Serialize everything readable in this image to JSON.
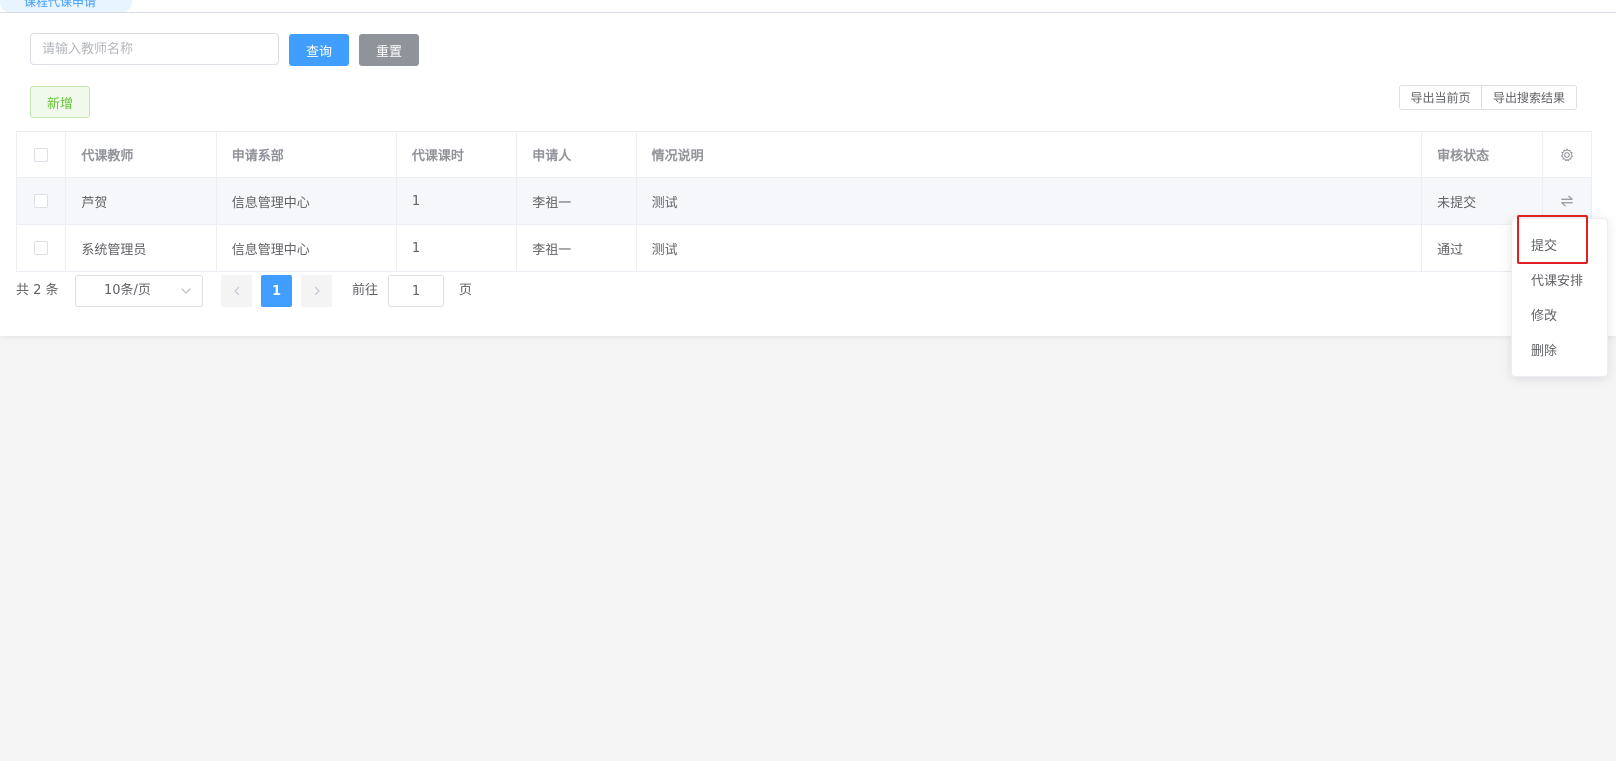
{
  "header": {
    "active_tab": "课程代课申请"
  },
  "search": {
    "placeholder": "请输入教师名称",
    "value": ""
  },
  "toolbar": {
    "query_label": "查询",
    "reset_label": "重置",
    "add_label": "新增",
    "export_current_label": "导出当前页",
    "export_search_label": "导出搜索结果"
  },
  "table": {
    "columns": [
      "代课教师",
      "申请系部",
      "代课课时",
      "申请人",
      "情况说明",
      "审核状态"
    ],
    "rows": [
      {
        "teacher": "芦贺",
        "department": "信息管理中心",
        "hours": "1",
        "applicant": "李祖一",
        "description": "测试",
        "status": "未提交"
      },
      {
        "teacher": "系统管理员",
        "department": "信息管理中心",
        "hours": "1",
        "applicant": "李祖一",
        "description": "测试",
        "status": "通过"
      }
    ],
    "settings_icon": "gear-icon",
    "row_action_icon": "swap-icon"
  },
  "pagination": {
    "total_text": "共 2 条",
    "page_size": "10条/页",
    "current_page": "1",
    "goto_label": "前往",
    "goto_value": "1",
    "page_unit": "页"
  },
  "dropdown_menu": {
    "items": [
      "提交",
      "代课安排",
      "修改",
      "删除"
    ],
    "highlighted": "提交"
  },
  "colors": {
    "primary": "#409eff",
    "reset": "#909399",
    "success": "#67c23a",
    "highlight": "#e02020"
  }
}
